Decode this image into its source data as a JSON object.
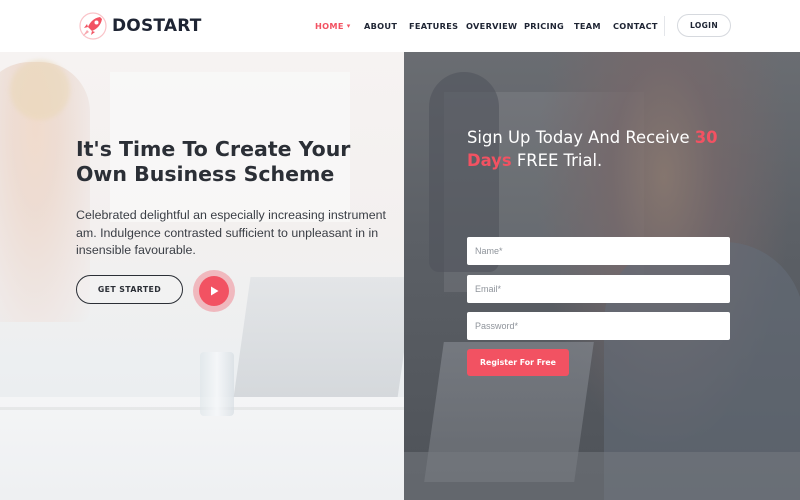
{
  "brand": {
    "name": "DOSTART",
    "accent": "#f25262",
    "dark": "#1e2433"
  },
  "nav": {
    "items": [
      {
        "label": "HOME",
        "active": true,
        "has_dropdown": true
      },
      {
        "label": "ABOUT"
      },
      {
        "label": "FEATURES"
      },
      {
        "label": "OVERVIEW"
      },
      {
        "label": "PRICING"
      },
      {
        "label": "TEAM"
      },
      {
        "label": "CONTACT"
      }
    ],
    "login_label": "LOGIN"
  },
  "hero": {
    "title": "It's Time To Create Your Own Business Scheme",
    "description": "Celebrated delightful an especially increasing instrument am. Indulgence contrasted sufficient to unpleasant in in insensible favourable.",
    "cta_label": "GET STARTED",
    "play_icon": "play-icon"
  },
  "signup": {
    "title_prefix": "Sign Up Today And Receive ",
    "title_highlight": "30 Days",
    "title_suffix": " FREE Trial.",
    "fields": {
      "name_placeholder": "Name*",
      "email_placeholder": "Email*",
      "password_placeholder": "Password*"
    },
    "button_label": "Register For Free"
  }
}
